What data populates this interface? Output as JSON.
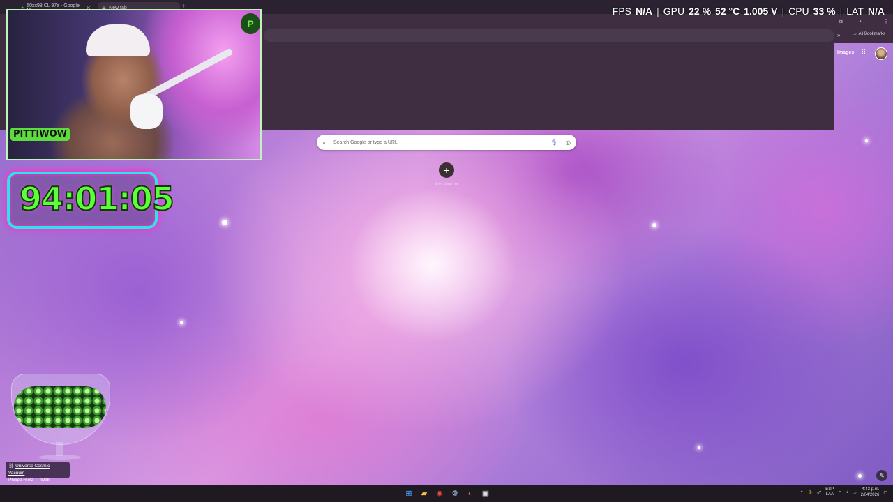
{
  "browser": {
    "tabs": [
      {
        "label": "50xx98 CL 97a - Google Maps",
        "active": false
      },
      {
        "label": "New tab",
        "active": true
      }
    ],
    "new_tab_symbol": "+",
    "all_bookmarks": "All Bookmarks"
  },
  "google": {
    "images_link": "Images",
    "search_placeholder": "Search Google or type a URL",
    "add_shortcut_label": "Add shortcut"
  },
  "perf_hud": {
    "fps_label": "FPS",
    "fps_value": "N/A",
    "gpu_label": "GPU",
    "gpu_usage": "22 %",
    "gpu_temp": "52 °C",
    "gpu_voltage": "1.005 V",
    "cpu_label": "CPU",
    "cpu_usage": "33 %",
    "lat_label": "LAT",
    "lat_value": "N/A"
  },
  "overlay": {
    "timer": "94:01:05",
    "webcam_logo": "PITTIWOW",
    "webcam_leaf_letter": "P"
  },
  "wallpaper_credit": {
    "title": "Universe Cosmic Vacuum",
    "author": "Philipp Rietz — Walli"
  },
  "taskbar": {
    "lang_top": "ESP",
    "lang_bottom": "LAA",
    "time": "4:43 p.m.",
    "date": "2/04/2026"
  },
  "colors": {
    "timer_green": "#5cff3a",
    "timer_border": "#2ae6e6",
    "timer_glow": "#ff2fd0",
    "browser_toolbar": "#3f2e42"
  },
  "icons": [
    "search-icon",
    "mic-icon",
    "google-lens-icon",
    "apps-grid-icon",
    "plus-icon",
    "pencil-icon",
    "windows-start-icon",
    "file-explorer-icon",
    "chrome-icon",
    "steam-icon",
    "link-icon"
  ]
}
